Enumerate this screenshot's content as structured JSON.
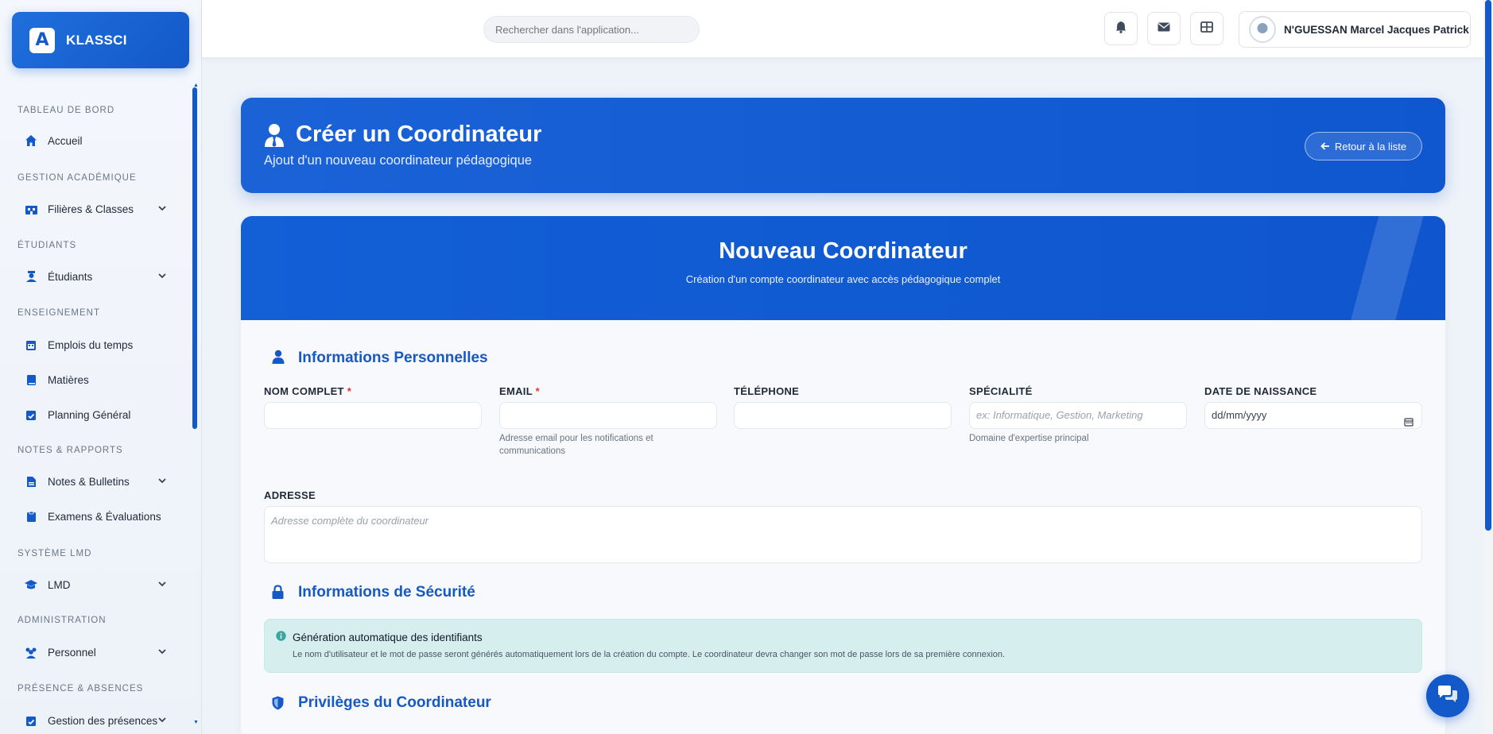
{
  "brand": {
    "name": "KLASSCI",
    "badge": "A"
  },
  "search": {
    "placeholder": "Rechercher dans l'application..."
  },
  "user": {
    "name": "N'GUESSAN Marcel Jacques Patrick"
  },
  "sidebar": {
    "sections": [
      {
        "title": "TABLEAU DE BORD"
      },
      {
        "title": "GESTION ACADÉMIQUE"
      },
      {
        "title": "ÉTUDIANTS"
      },
      {
        "title": "ENSEIGNEMENT"
      },
      {
        "title": "NOTES & RAPPORTS"
      },
      {
        "title": "SYSTÈME LMD"
      },
      {
        "title": "ADMINISTRATION"
      },
      {
        "title": "PRÉSENCE & ABSENCES"
      }
    ],
    "items": [
      {
        "label": "Accueil",
        "icon": "home-icon"
      },
      {
        "label": "Filières & Classes",
        "icon": "building-icon"
      },
      {
        "label": "Étudiants",
        "icon": "student-icon"
      },
      {
        "label": "Emplois du temps",
        "icon": "calendar-icon"
      },
      {
        "label": "Matières",
        "icon": "book-icon"
      },
      {
        "label": "Planning Général",
        "icon": "calendar-check-icon"
      },
      {
        "label": "Notes & Bulletins",
        "icon": "file-icon"
      },
      {
        "label": "Examens & Évaluations",
        "icon": "clipboard-icon"
      },
      {
        "label": "LMD",
        "icon": "graduation-cap-icon"
      },
      {
        "label": "Personnel",
        "icon": "users-icon"
      },
      {
        "label": "Gestion des présences",
        "icon": "calendar-check-icon"
      }
    ]
  },
  "header": {
    "title": "Créer un Coordinateur",
    "subtitle": "Ajout d'un nouveau coordinateur pédagogique",
    "back_label": "Retour à la liste"
  },
  "form": {
    "title": "Nouveau Coordinateur",
    "subtitle": "Création d'un compte coordinateur avec accès pédagogique complet",
    "sections": {
      "personal": "Informations Personnelles",
      "security": "Informations de Sécurité",
      "privileges": "Privilèges du Coordinateur"
    },
    "fields": {
      "name": {
        "label": "NOM COMPLET",
        "required": "*",
        "value": ""
      },
      "email": {
        "label": "EMAIL",
        "required": "*",
        "value": "",
        "help": "Adresse email pour les notifications et communications"
      },
      "phone": {
        "label": "TÉLÉPHONE",
        "value": ""
      },
      "specialty": {
        "label": "SPÉCIALITÉ",
        "placeholder": "ex: Informatique, Gestion, Marketing",
        "help": "Domaine d'expertise principal"
      },
      "birthdate": {
        "label": "DATE DE NAISSANCE",
        "placeholder": "dd/mm/yyyy"
      },
      "address": {
        "label": "ADRESSE",
        "placeholder": "Adresse complète du coordinateur"
      }
    },
    "alert": {
      "title": "Génération automatique des identifiants",
      "text": "Le nom d'utilisateur et le mot de passe seront générés automatiquement lors de la création du compte. Le coordinateur devra changer son mot de passe lors de sa première connexion."
    }
  },
  "colors": {
    "primary": "#1359c9",
    "accent_text": "#1559c6",
    "alert_bg": "#d6eeee",
    "required": "#e3342f"
  }
}
